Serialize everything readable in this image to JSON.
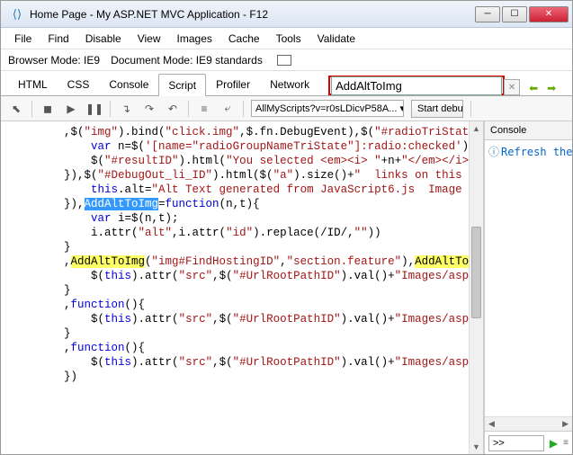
{
  "window": {
    "title": "Home Page - My ASP.NET MVC Application - F12"
  },
  "menu": {
    "file": "File",
    "find": "Find",
    "disable": "Disable",
    "view": "View",
    "images": "Images",
    "cache": "Cache",
    "tools": "Tools",
    "validate": "Validate"
  },
  "mode": {
    "browser_label": "Browser Mode:",
    "browser_value": "IE9",
    "doc_label": "Document Mode:",
    "doc_value": "IE9 standards"
  },
  "tabs": {
    "html": "HTML",
    "css": "CSS",
    "console": "Console",
    "script": "Script",
    "profiler": "Profiler",
    "network": "Network"
  },
  "search": {
    "value": "AddAltToImg"
  },
  "toolbar": {
    "script_selector": "AllMyScripts?v=r0sLDicvP58A... ▾",
    "start_debug": "Start debu"
  },
  "sidepanel": {
    "tab": "Console",
    "refresh_msg": "Refresh the",
    "prompt": ">>"
  },
  "code": {
    "l1a": ",$(",
    "l1b": "\"img\"",
    "l1c": ").bind(",
    "l1d": "\"click.img\"",
    "l1e": ",$.fn.DebugEvent),$(",
    "l1f": "\"#radioTriStat",
    "l2a": "var",
    "l2b": " n=$(",
    "l2c": "'[name=\"radioGroupNameTriState\"]:radio:checked'",
    "l2d": ")",
    "l3a": "$(",
    "l3b": "\"#resultID\"",
    "l3c": ").html(",
    "l3d": "\"You selected <em><i> \"",
    "l3e": "+n+",
    "l3f": "\"</em></i>",
    "l4a": "}),$(",
    "l4b": "\"#DebugOut_li_ID\"",
    "l4c": ").html($(",
    "l4d": "\"a\"",
    "l4e": ").size()+",
    "l4f": "\"  links on this p",
    "l5a": "this",
    "l5b": ".alt=",
    "l5c": "\"Alt Text generated from JavaScript6.js  Image ",
    "l6a": "}),",
    "l6b": "AddAltToImg",
    "l6c": "=",
    "l6d": "function",
    "l6e": "(n,t){",
    "l7a": "var",
    "l7b": " i=$(n,t);",
    "l8a": "i.attr(",
    "l8b": "\"alt\"",
    "l8c": ",i.attr(",
    "l8d": "\"id\"",
    "l8e": ").replace(",
    "l8f": "/ID/",
    "l8g": ",",
    "l8h": "\"\"",
    "l8i": "))",
    "l9": "}",
    "l10a": ",",
    "l10b": "AddAltToImg",
    "l10c": "(",
    "l10d": "\"img#FindHostingID\"",
    "l10e": ",",
    "l10f": "\"section.feature\"",
    "l10g": "),",
    "l10h": "AddAltTo",
    "l11a": "$(",
    "l11b": "this",
    "l11c": ").attr(",
    "l11d": "\"src\"",
    "l11e": ",$(",
    "l11f": "\"#UrlRootPathID\"",
    "l11g": ").val()+",
    "l11h": "\"Images/asp",
    "l12": "}",
    "l13a": ",",
    "l13b": "function",
    "l13c": "(){",
    "l14a": "$(",
    "l14b": "this",
    "l14c": ").attr(",
    "l14d": "\"src\"",
    "l14e": ",$(",
    "l14f": "\"#UrlRootPathID\"",
    "l14g": ").val()+",
    "l14h": "\"Images/asp",
    "l15": "}",
    "l16a": ",",
    "l16b": "function",
    "l16c": "(){",
    "l17a": "$(",
    "l17b": "this",
    "l17c": ").attr(",
    "l17d": "\"src\"",
    "l17e": ",$(",
    "l17f": "\"#UrlRootPathID\"",
    "l17g": ").val()+",
    "l17h": "\"Images/asp",
    "l18": "})"
  }
}
